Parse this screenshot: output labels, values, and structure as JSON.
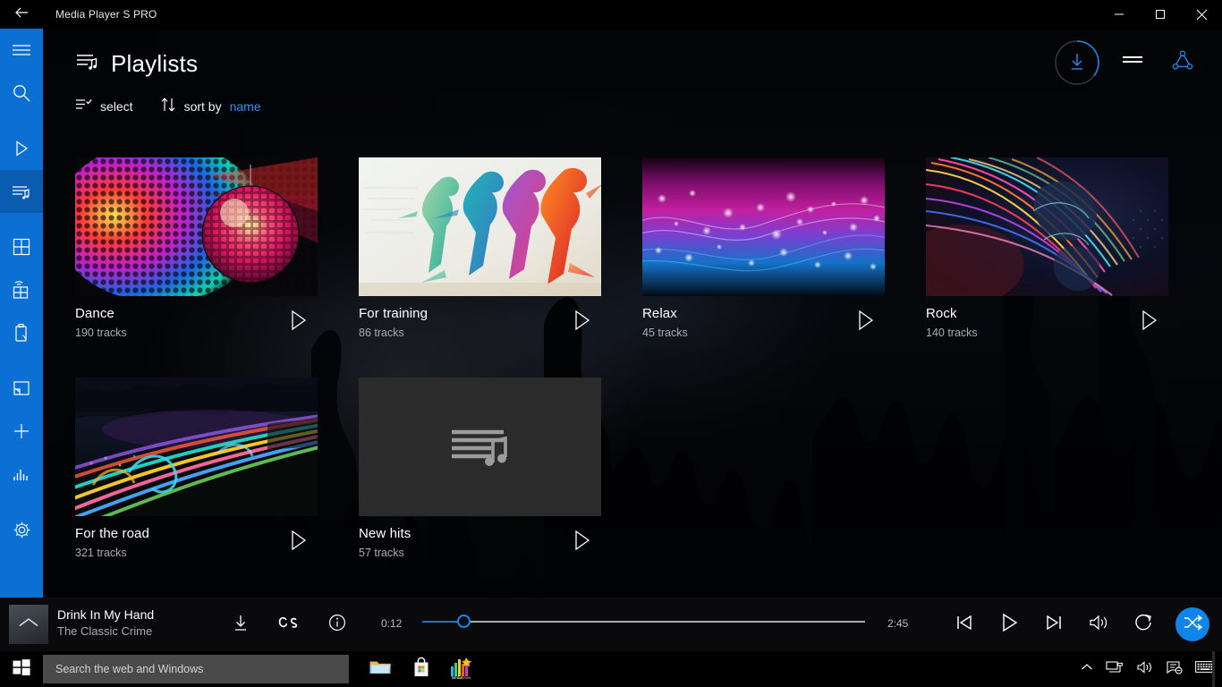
{
  "window": {
    "title": "Media Player S  PRO",
    "back_icon": "back-arrow-icon",
    "minimize_icon": "minimize-icon",
    "maximize_icon": "maximize-icon",
    "close_icon": "close-icon"
  },
  "sidebar": {
    "items": [
      {
        "id": "menu",
        "icon": "hamburger-menu-icon",
        "active": false
      },
      {
        "id": "search",
        "icon": "search-icon",
        "active": false
      },
      {
        "id": "nowplaying",
        "icon": "play-triangle-icon",
        "active": false
      },
      {
        "id": "playlists",
        "icon": "playlist-music-icon",
        "active": true
      },
      {
        "id": "library",
        "icon": "grid-icon",
        "active": false
      },
      {
        "id": "network",
        "icon": "grid-wifi-icon",
        "active": false
      },
      {
        "id": "device",
        "icon": "usb-device-icon",
        "active": false
      },
      {
        "id": "cast",
        "icon": "cast-screen-icon",
        "active": false
      },
      {
        "id": "add",
        "icon": "plus-icon",
        "active": false
      },
      {
        "id": "equalizer",
        "icon": "equalizer-icon",
        "active": false
      },
      {
        "id": "settings",
        "icon": "gear-icon",
        "active": false
      }
    ]
  },
  "header": {
    "title": "Playlists",
    "title_icon": "playlist-music-icon",
    "download_icon": "download-circle-icon",
    "list_icon": "list-lines-icon",
    "share_icon": "share-nodes-icon",
    "accent_color": "#1b86e8"
  },
  "toolbar": {
    "select_label": "select",
    "select_icon": "select-list-icon",
    "sort_label": "sort by",
    "sort_icon": "sort-arrows-icon",
    "sort_value": "name",
    "sort_value_color": "#2f93f0"
  },
  "playlists": [
    {
      "title": "Dance",
      "tracks": "190 tracks",
      "art": "disco-ball",
      "play_icon": "play-triangle-icon"
    },
    {
      "title": "For training",
      "tracks": "86 tracks",
      "art": "runners",
      "play_icon": "play-triangle-icon"
    },
    {
      "title": "Relax",
      "tracks": "45 tracks",
      "art": "bokeh-waves",
      "play_icon": "play-triangle-icon"
    },
    {
      "title": "Rock",
      "tracks": "140 tracks",
      "art": "light-fan",
      "play_icon": "play-triangle-icon"
    },
    {
      "title": "For the road",
      "tracks": "321 tracks",
      "art": "light-trails",
      "play_icon": "play-triangle-icon"
    },
    {
      "title": "New hits",
      "tracks": "57 tracks",
      "art": "placeholder",
      "play_icon": "play-triangle-icon"
    }
  ],
  "now_playing": {
    "track_title": "Drink In My Hand",
    "artist": "The Classic Crime",
    "album_art_icon": "chevron-up-icon",
    "download_icon": "download-icon",
    "lastfm_icon": "lastfm-icon",
    "info_icon": "info-circle-icon",
    "current_time": "0:12",
    "total_time": "2:45",
    "progress_percent": 9,
    "previous_icon": "previous-track-icon",
    "play_icon": "play-triangle-icon",
    "next_icon": "next-track-icon",
    "volume_icon": "volume-icon",
    "repeat_icon": "repeat-icon",
    "shuffle_icon": "shuffle-icon",
    "shuffle_color": "#0e85e8"
  },
  "taskbar": {
    "start_icon": "windows-start-icon",
    "search_placeholder": "Search the web and Windows",
    "apps": [
      {
        "id": "file-explorer",
        "icon": "folder-icon"
      },
      {
        "id": "store",
        "icon": "store-bag-icon"
      },
      {
        "id": "media-player",
        "icon": "media-player-icon"
      }
    ],
    "tray": [
      {
        "id": "show-hidden",
        "icon": "chevron-up-icon"
      },
      {
        "id": "network",
        "icon": "network-icon"
      },
      {
        "id": "volume",
        "icon": "volume-icon"
      },
      {
        "id": "action-center",
        "icon": "action-center-icon"
      },
      {
        "id": "keyboard",
        "icon": "keyboard-icon"
      }
    ]
  }
}
